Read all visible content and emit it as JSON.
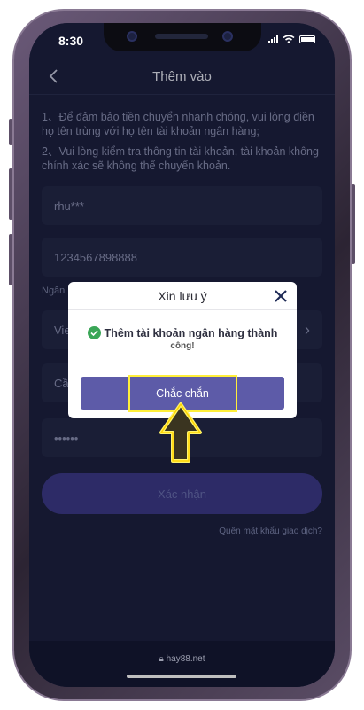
{
  "status": {
    "time": "8:30"
  },
  "header": {
    "title": "Thêm vào"
  },
  "notes": [
    "1、Để đảm bảo tiền chuyển nhanh chóng, vui lòng điền họ tên trùng với họ tên tài khoản ngân hàng;",
    "2、Vui lòng kiểm tra thông tin tài khoản, tài khoản không chính xác sẽ không thể chuyển khoản."
  ],
  "form": {
    "name_value": "rhu***",
    "account_value": "1234567898888",
    "bank_label": "Ngân hàng",
    "bank_value": "Vie",
    "branch_value": "Cầ",
    "password_value": "••••••"
  },
  "confirm_label": "Xác nhận",
  "forgot_label": "Quên mật khẩu giao dịch?",
  "footer": {
    "url": "hay88.net"
  },
  "modal": {
    "title": "Xin lưu ý",
    "message_line1": "Thêm tài khoản ngân hàng thành",
    "message_line2": "công!",
    "button_label": "Chắc chắn"
  },
  "colors": {
    "background": "#1d2140",
    "accent": "#5d5ba8",
    "highlight": "#ffef3a",
    "success": "#3aa657"
  }
}
